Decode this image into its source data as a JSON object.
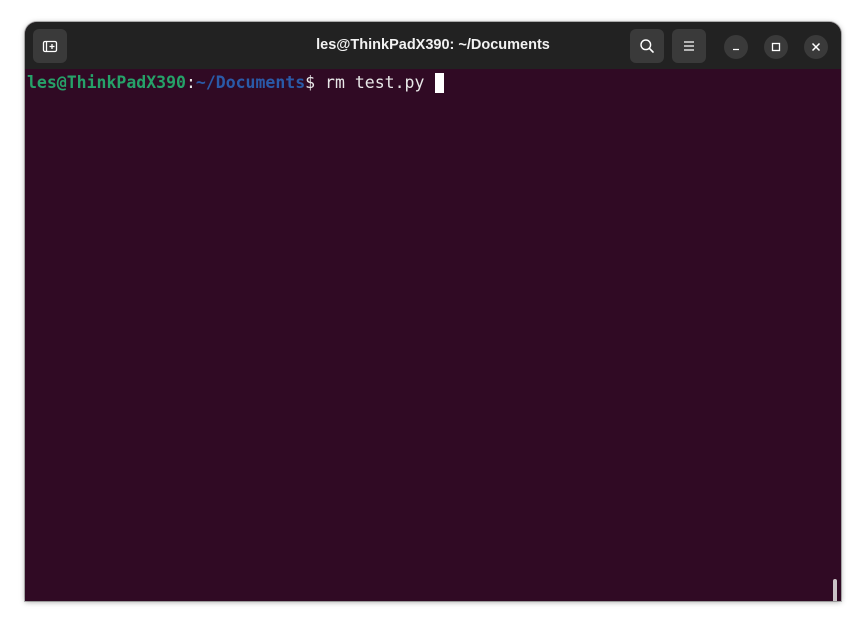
{
  "window": {
    "title": "les@ThinkPadX390: ~/Documents"
  },
  "titlebar": {
    "new_tab_icon": "new-tab-icon",
    "search_icon": "search-icon",
    "menu_icon": "hamburger-menu-icon",
    "minimize_icon": "minimize-icon",
    "maximize_icon": "maximize-icon",
    "close_icon": "close-icon"
  },
  "terminal": {
    "prompt_user": "les@ThinkPadX390",
    "prompt_colon": ":",
    "prompt_path": "~/Documents",
    "prompt_symbol": "$",
    "command": " rm test.py ",
    "colors": {
      "background": "#300a24",
      "user": "#26a269",
      "path": "#2a5aa8",
      "text": "#e8e8e8"
    }
  }
}
